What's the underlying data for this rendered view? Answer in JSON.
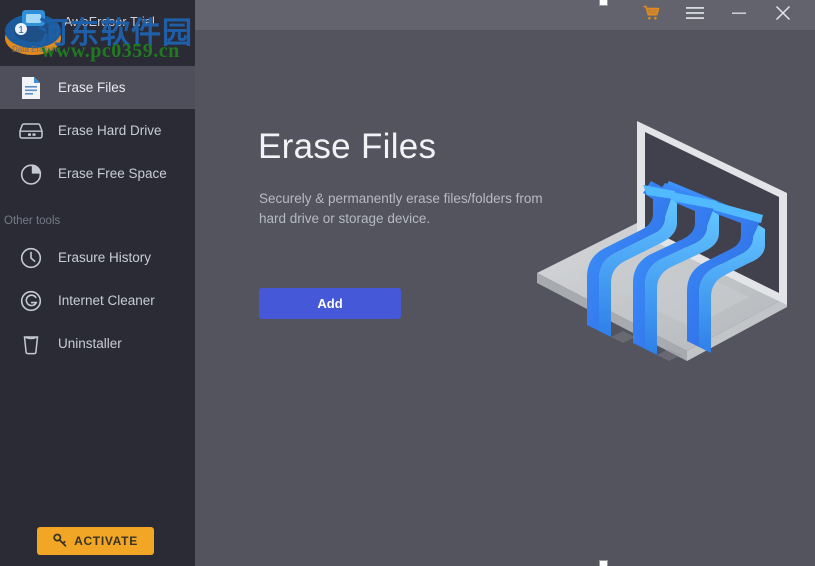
{
  "app": {
    "title": "AweEraser Trial",
    "logo_text": "Data Erasure"
  },
  "watermark": {
    "cn_text": "河东软件园",
    "url_text": "www.pc0359.cn",
    "cn_color": "#1f5fa8",
    "url_color": "#1f7a20"
  },
  "titlebar": {
    "cart_icon": "shopping-cart-icon",
    "menu_icon": "hamburger-menu-icon",
    "minimize_icon": "minimize-icon",
    "close_icon": "close-icon"
  },
  "sidebar": {
    "background": "#2b2b36",
    "items": [
      {
        "label": "Erase Files",
        "icon": "document-file-icon",
        "active": true
      },
      {
        "label": "Erase Hard Drive",
        "icon": "hard-drive-icon",
        "active": false
      },
      {
        "label": "Erase Free Space",
        "icon": "pie-chart-icon",
        "active": false
      }
    ],
    "section_label": "Other tools",
    "tools": [
      {
        "label": "Erasure History",
        "icon": "clock-icon"
      },
      {
        "label": "Internet Cleaner",
        "icon": "globe-icon"
      },
      {
        "label": "Uninstaller",
        "icon": "trash-bin-icon"
      }
    ],
    "activate": {
      "label": "ACTIVATE",
      "icon": "key-icon",
      "color": "#f1a626"
    }
  },
  "main": {
    "background": "#54545f",
    "title": "Erase Files",
    "subtitle": "Securely & permanently erase files/folders from hard drive or storage device.",
    "add_button": {
      "label": "Add",
      "color": "#4558d8"
    },
    "illustration": "laptop-data-erasure-illustration"
  }
}
